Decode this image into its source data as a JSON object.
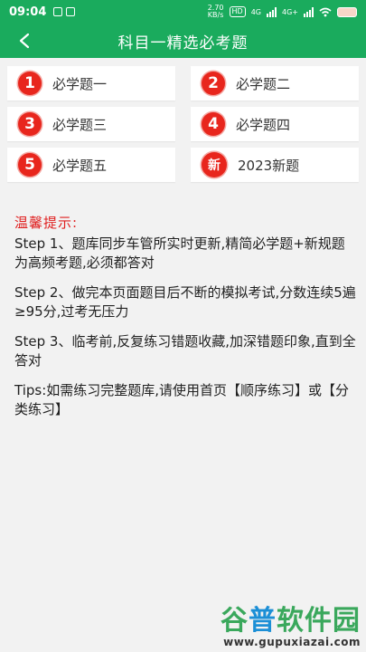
{
  "status_bar": {
    "time": "09:04",
    "speed_value": "2.70",
    "speed_unit": "KB/s",
    "hd_label": "HD",
    "network_label": "4G",
    "network2_label": "4G+"
  },
  "header": {
    "title": "科目一精选必考题",
    "background_color": "#1aab5d"
  },
  "cards": [
    {
      "badge": "1",
      "label": "必学题一"
    },
    {
      "badge": "2",
      "label": "必学题二"
    },
    {
      "badge": "3",
      "label": "必学题三"
    },
    {
      "badge": "4",
      "label": "必学题四"
    },
    {
      "badge": "5",
      "label": "必学题五"
    },
    {
      "badge": "新",
      "label": "2023新题"
    }
  ],
  "tips": {
    "heading": "温馨提示:",
    "paragraphs": [
      "Step 1、题库同步车管所实时更新,精简必学题+新规题为高频考题,必须都答对",
      "Step 2、做完本页面题目后不断的模拟考试,分数连续5遍≥95分,过考无压力",
      "Step 3、临考前,反复练习错题收藏,加深错题印象,直到全答对",
      "Tips:如需练习完整题库,请使用首页【顺序练习】或【分类练习】"
    ]
  },
  "watermark": {
    "part1": "谷",
    "part2": "普",
    "part3": "软件园",
    "url": "www.gupuxiazai.com"
  },
  "colors": {
    "accent": "#1aab5d",
    "badge": "#e8261d",
    "tips_heading": "#e02020"
  }
}
